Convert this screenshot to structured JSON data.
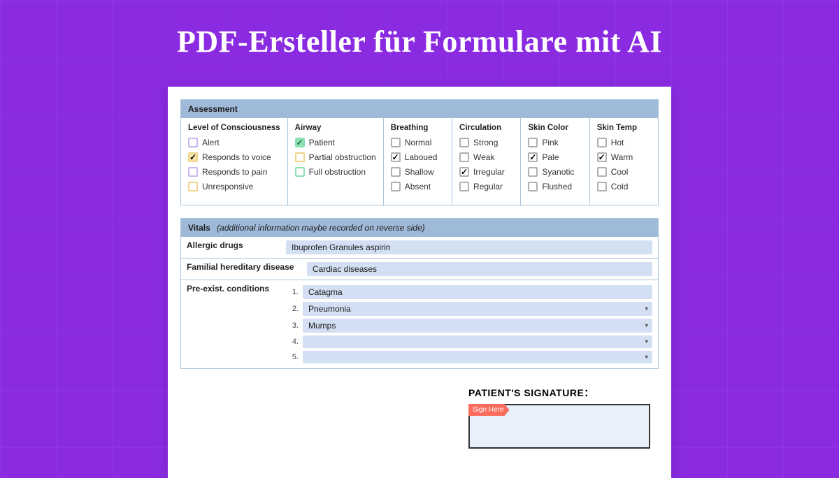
{
  "hero": {
    "title": "PDF-Ersteller für Formulare mit AI"
  },
  "assessment": {
    "header": "Assessment",
    "columns": [
      {
        "title": "Level of Consciousness",
        "items": [
          {
            "label": "Alert",
            "color": "purple",
            "checked": false
          },
          {
            "label": "Responds to voice",
            "color": "yellow",
            "checked": true
          },
          {
            "label": "Responds to pain",
            "color": "purple",
            "checked": false
          },
          {
            "label": "Unresponsive",
            "color": "yellow",
            "checked": false
          }
        ]
      },
      {
        "title": "Airway",
        "items": [
          {
            "label": "Patient",
            "color": "green",
            "checked": true
          },
          {
            "label": "Partial obstruction",
            "color": "yellow",
            "checked": false
          },
          {
            "label": "Full obstruction",
            "color": "green",
            "checked": false
          }
        ]
      },
      {
        "title": "Breathing",
        "items": [
          {
            "label": "Normal",
            "color": "gray",
            "checked": false
          },
          {
            "label": "Laboued",
            "color": "gray",
            "checked": true
          },
          {
            "label": "Shallow",
            "color": "gray",
            "checked": false
          },
          {
            "label": "Absent",
            "color": "gray",
            "checked": false
          }
        ]
      },
      {
        "title": "Circulation",
        "items": [
          {
            "label": "Strong",
            "color": "gray",
            "checked": false
          },
          {
            "label": "Weak",
            "color": "gray",
            "checked": false
          },
          {
            "label": "Irregular",
            "color": "gray",
            "checked": true
          },
          {
            "label": "Regular",
            "color": "gray",
            "checked": false
          }
        ]
      },
      {
        "title": "Skin Color",
        "items": [
          {
            "label": "Pink",
            "color": "gray",
            "checked": false
          },
          {
            "label": "Pale",
            "color": "gray",
            "checked": true
          },
          {
            "label": "Syanotic",
            "color": "gray",
            "checked": false
          },
          {
            "label": "Flushed",
            "color": "gray",
            "checked": false
          }
        ]
      },
      {
        "title": "Skin Temp",
        "items": [
          {
            "label": "Hot",
            "color": "gray",
            "checked": false
          },
          {
            "label": "Warm",
            "color": "gray",
            "checked": true
          },
          {
            "label": "Cool",
            "color": "gray",
            "checked": false
          },
          {
            "label": "Cold",
            "color": "gray",
            "checked": false
          }
        ]
      }
    ]
  },
  "vitals": {
    "header": "Vitals",
    "note": "(additional information maybe recorded on reverse side)",
    "allergic_label": "Allergic drugs",
    "allergic_value": "Ibuprofen Granules  aspirin",
    "familial_label": "Familial hereditary disease",
    "familial_value": "Cardiac diseases",
    "preexist_label": "Pre-exist. conditions",
    "conditions": [
      {
        "n": "1.",
        "value": "Catagma",
        "hasCaret": false
      },
      {
        "n": "2.",
        "value": "Pneumonia",
        "hasCaret": true
      },
      {
        "n": "3.",
        "value": "Mumps",
        "hasCaret": true
      },
      {
        "n": "4.",
        "value": "",
        "hasCaret": true
      },
      {
        "n": "5.",
        "value": "",
        "hasCaret": true
      }
    ]
  },
  "signature": {
    "title": "PATIENT'S SIGNATURE：",
    "tag": "Sign Here"
  }
}
